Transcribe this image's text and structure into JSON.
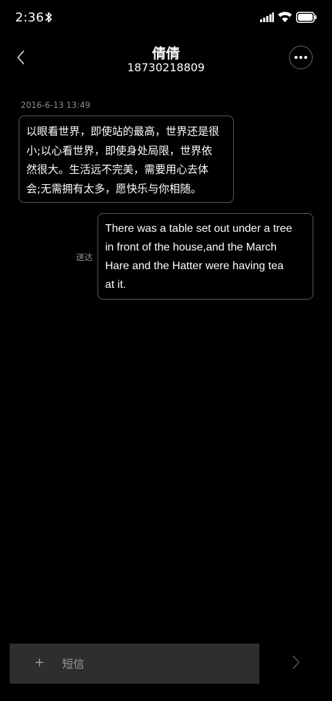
{
  "status_bar": {
    "time": "2:36",
    "icons": [
      "bluetooth-icon",
      "signal-icon",
      "wifi-icon",
      "battery-icon"
    ]
  },
  "header": {
    "contact_name": "倩倩",
    "phone_number": "18730218809",
    "back_icon": "chevron-left-icon",
    "more_icon": "more-horizontal-icon"
  },
  "messages": [
    {
      "direction": "incoming",
      "timestamp": "2016-6-13 13:49",
      "lines": [
        "以眼看世界，即使站的最高，世界还是很",
        "小;以心看世界，即使身处局限，世界依",
        "然很大。生活远不完美，需要用心去体",
        "会;无需拥有太多，愿快乐与你相随。"
      ]
    },
    {
      "direction": "outgoing",
      "status": "送达",
      "lines": [
        "There was a table set out under a tree",
        "in front of the house,and the March",
        "Hare and the Hatter were having tea",
        "at it."
      ]
    }
  ],
  "composer": {
    "plus_label": "+",
    "placeholder": "短信",
    "send_icon": "chevron-right-icon"
  },
  "colors": {
    "background": "#000000",
    "bubble_border": "#5a5a5a",
    "input_background": "#2e2e2e",
    "secondary_text": "#8a8a8a"
  }
}
